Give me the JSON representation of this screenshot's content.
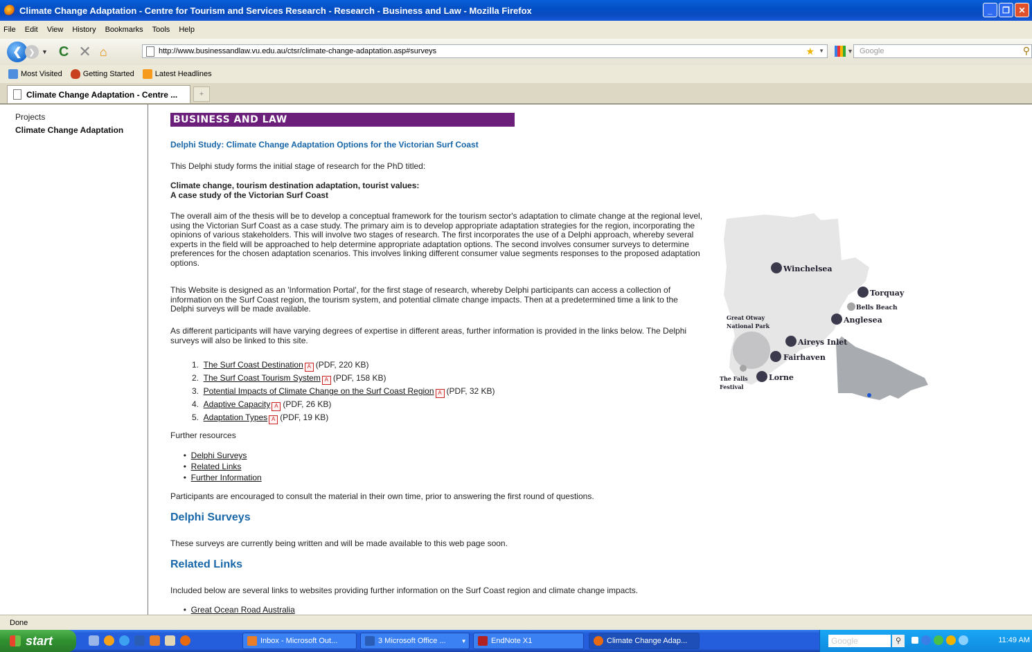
{
  "window": {
    "title": "Climate Change Adaptation - Centre for Tourism and Services Research - Research - Business and Law - Mozilla Firefox"
  },
  "menu": [
    "File",
    "Edit",
    "View",
    "History",
    "Bookmarks",
    "Tools",
    "Help"
  ],
  "toolbar": {
    "url": "http://www.businessandlaw.vu.edu.au/ctsr/climate-change-adaptation.asp#surveys",
    "search_placeholder": "Google"
  },
  "bookmarks": [
    "Most Visited",
    "Getting Started",
    "Latest Headlines"
  ],
  "tab": {
    "label": "Climate Change Adaptation - Centre ..."
  },
  "sidebar": {
    "items": [
      "Projects",
      "Climate Change Adaptation"
    ]
  },
  "page": {
    "banner": "BUSINESS AND LAW",
    "study_title": "Delphi Study: Climate Change Adaptation Options for the Victorian Surf Coast",
    "intro": "This Delphi study forms the initial stage of research for the PhD titled:",
    "thesis_line1": "Climate change, tourism destination adaptation, tourist values:",
    "thesis_line2": "A case study of the Victorian Surf Coast",
    "aim": "The overall aim of the thesis will be to develop a conceptual framework for the tourism sector's adaptation to climate change at the regional level, using the Victorian Surf Coast as a case study. The primary aim is to develop appropriate adaptation strategies for the region, incorporating the opinions of various stakeholders. This will involve two stages of research. The first incorporates the use of a Delphi approach, whereby several experts in the field will be approached to help determine appropriate adaptation options. The second involves consumer surveys to determine preferences for the chosen adaptation scenarios. This involves linking different consumer value segments responses to the proposed adaptation options.",
    "portal": "This Website is designed as an 'Information Portal', for the first stage of research, whereby Delphi participants can access a collection of information on the Surf Coast region, the tourism system, and potential climate change impacts. Then at a predetermined time a link to the Delphi surveys will be made available.",
    "expertise": "As different participants will have varying degrees of expertise in different areas, further information is provided in the links below. The Delphi surveys will also be linked to this site.",
    "documents": [
      {
        "num": "1.",
        "title": "The Surf Coast Destination",
        "meta": "(PDF, 220 KB)"
      },
      {
        "num": "2.",
        "title": "The Surf Coast Tourism System",
        "meta": "(PDF, 158 KB)"
      },
      {
        "num": "3.",
        "title": "Potential Impacts of Climate Change on the Surf Coast Region",
        "meta": "(PDF, 32 KB)"
      },
      {
        "num": "4.",
        "title": "Adaptive Capacity",
        "meta": "(PDF, 26 KB)"
      },
      {
        "num": "5.",
        "title": "Adaptation Types",
        "meta": "(PDF, 19 KB)"
      }
    ],
    "further_resources_label": "Further resources",
    "resources": [
      "Delphi Surveys",
      "Related Links",
      "Further Information"
    ],
    "participants_note": "Participants are encouraged to consult the material in their own time, prior to answering the first round of questions.",
    "surveys_heading": "Delphi Surveys",
    "surveys_text": "These surveys are currently being written and will be made available to this web page soon.",
    "related_heading": "Related Links",
    "related_text": "Included below are several links to websites providing further information on the Surf Coast region and climate change impacts.",
    "related_links": [
      "Great Ocean Road Australia"
    ]
  },
  "map": {
    "places": [
      "Winchelsea",
      "Torquay",
      "Bells Beach",
      "Anglesea",
      "Aireys Inlet",
      "Fairhaven",
      "Lorne"
    ],
    "park_label_1": "Great Otway",
    "park_label_2": "National Park",
    "falls_label_1": "The Falls",
    "falls_label_2": "Festival",
    "colors": {
      "land": "#e6e6e6",
      "victoria": "#a8abb0",
      "town": "#3a3a4c",
      "minor": "#a5a5a5"
    }
  },
  "status": {
    "text": "Done"
  },
  "taskbar": {
    "start": "start",
    "items": [
      "Inbox - Microsoft Out...",
      "3 Microsoft Office ...",
      "EndNote X1",
      "Climate Change Adap..."
    ],
    "tray_search": "Google",
    "clock": "11:49 AM"
  }
}
